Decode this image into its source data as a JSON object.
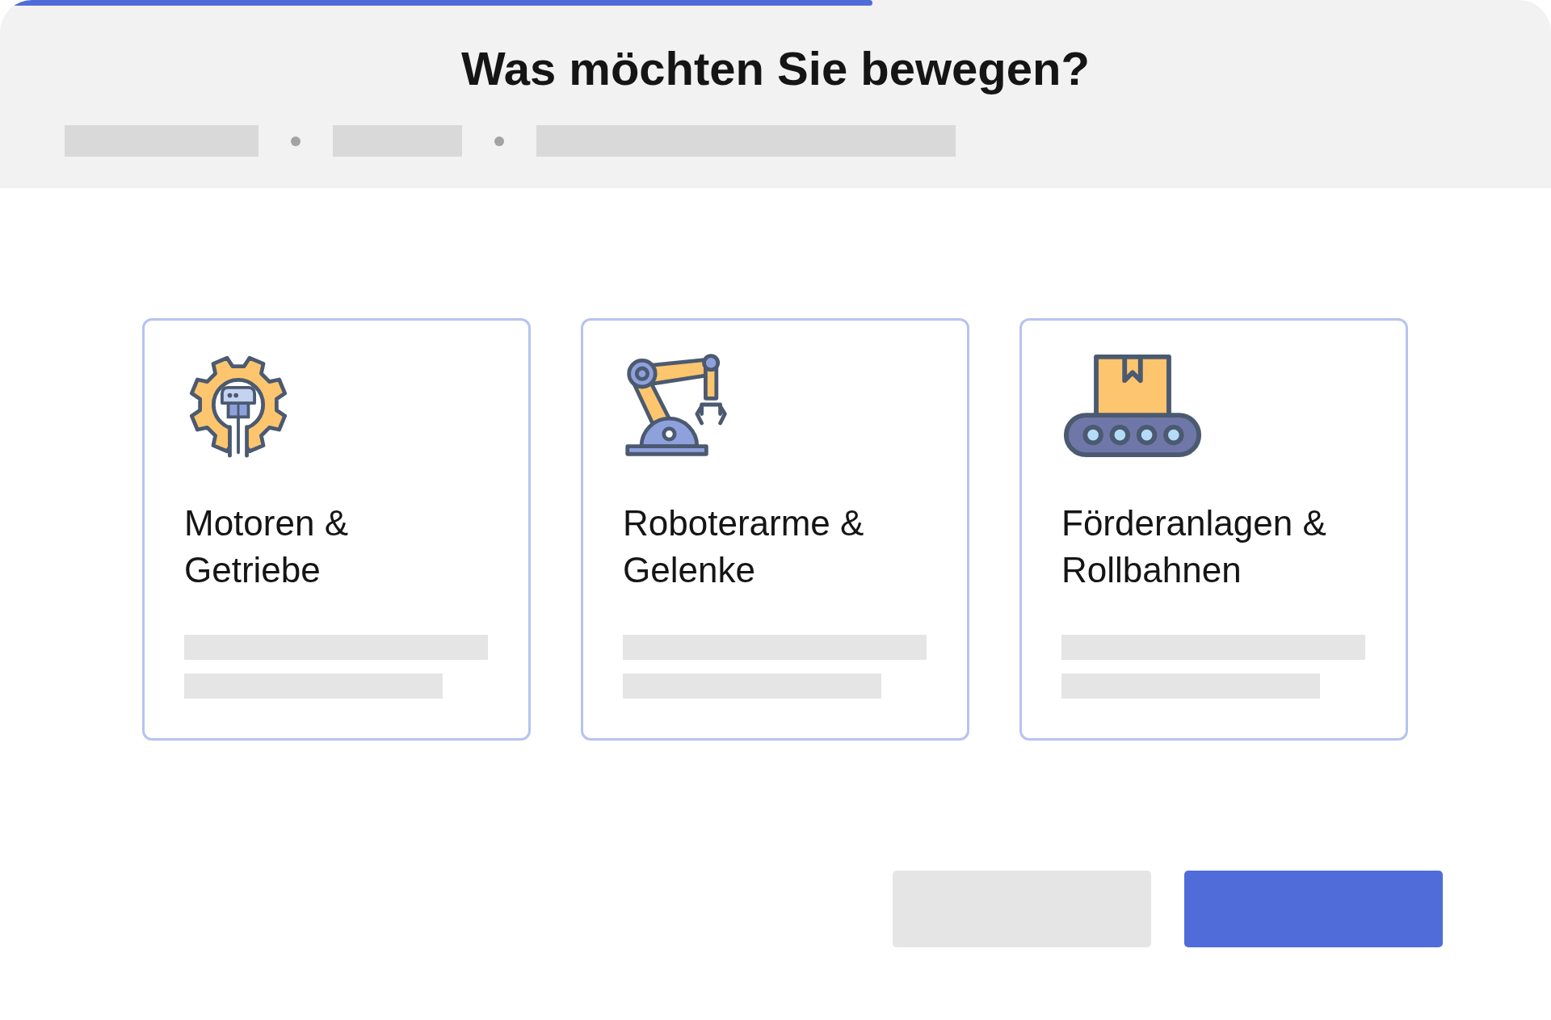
{
  "title": "Was möchten Sie bewegen?",
  "cards": [
    {
      "kind": "gear",
      "title": "Motoren &\nGetriebe"
    },
    {
      "kind": "robot-arm",
      "title": "Roboterarme &\nGelenke"
    },
    {
      "kind": "conveyor",
      "title": "Förderanlagen &\nRollbahnen"
    }
  ]
}
